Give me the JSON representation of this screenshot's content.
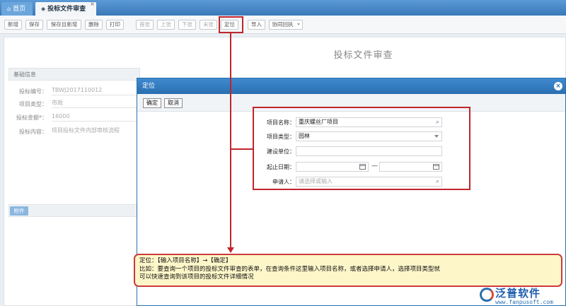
{
  "tabs": {
    "home_label": "首页",
    "active_label": "投标文件审查",
    "close_glyph": "×"
  },
  "toolbar": {
    "buttons": [
      "新增",
      "保存",
      "保存且新增",
      "删除",
      "打印",
      "首张",
      "上张",
      "下张",
      "末张",
      "定位",
      "导入",
      "协同回执"
    ]
  },
  "page": {
    "title": "投标文件审查",
    "section_basic": "基础信息",
    "fields": {
      "bid_no_label": "投标编号：",
      "bid_no_value": "TBWJ2017110012",
      "project_type_label": "项目类型：",
      "project_type_value": "市政",
      "amount_label": "投标金额*：",
      "amount_value": "16000",
      "content_label": "投标内容：",
      "content_value": "项目投标文件内部审核流程"
    },
    "attach_label": "附件"
  },
  "dialog": {
    "title": "定位",
    "confirm_label": "确定",
    "cancel_label": "取消",
    "project_name_label": "项目名称：",
    "project_name_value": "重庆螺丝厂项目",
    "project_type_label": "项目类型：",
    "project_type_value": "园林",
    "builder_label": "建设单位：",
    "builder_value": "",
    "date_label": "起止日期：",
    "date_separator": "—",
    "applicant_label": "申请人：",
    "applicant_placeholder": "请选择或输入"
  },
  "note": {
    "line1": "定位：【输入项目名称】→【确定】",
    "line2": "比如：要查询一个项目的投标文件审查的表单，在查询条件这里输入项目名称，或者选择申请人，选择项目类型就",
    "line3": "可以快速查询到该项目的投标文件详细情况"
  },
  "logo": {
    "name": "泛普软件",
    "url": "www.fanpusoft.com"
  },
  "colors": {
    "accent": "#2a6fb1",
    "annotation": "#c0252b",
    "note_bg": "#fdf6c9"
  },
  "icons": {
    "home": "home-icon",
    "tab": "document-icon",
    "search": "search-icon",
    "dropdown": "chevron-down-icon",
    "calendar": "calendar-icon",
    "close": "close-icon"
  }
}
